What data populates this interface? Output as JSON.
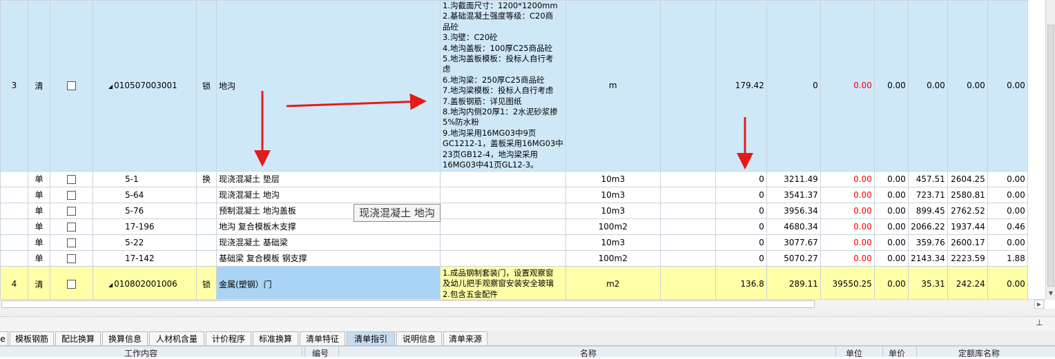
{
  "rows": [
    {
      "seq": "3",
      "type": "清",
      "code": "010507003001",
      "lock": "锁",
      "name": "地沟",
      "features": [
        "1.沟截面尺寸：1200*1200mm",
        "2.基础混凝土强度等级：C20商",
        "品砼",
        "3.沟壁：C20砼",
        "4.地沟盖板：100厚C25商品砼",
        "5.地沟盖板模板：投标人自行考",
        "虑",
        "6.地沟梁：250厚C25商品砼",
        "7.地沟梁模板：投标人自行考虑",
        "7.盖板钢筋：详见图纸",
        "8.地沟内侧20厚1：2水泥砂浆掺",
        "5%防水粉",
        "9.地沟采用16MG03中9页",
        "GC1212-1，盖板采用16MG03中",
        "23页GB12-4，地沟梁采用",
        "16MG03中41页GL12-3。"
      ],
      "unit": "m",
      "blank": "",
      "qty": "179.42",
      "price": "0",
      "total": "0.00",
      "v1": "0.00",
      "v2": "0.00",
      "v3": "0.00",
      "v4": "0.00"
    },
    {
      "seq": "",
      "type": "单",
      "code": "5-1",
      "lock": "换",
      "name": "现浇混凝土 垫层",
      "unit": "10m3",
      "blank": "",
      "qty": "0",
      "price": "3211.49",
      "total": "0.00",
      "v1": "0.00",
      "v2": "457.51",
      "v3": "2604.25",
      "v4": "0.00"
    },
    {
      "seq": "",
      "type": "单",
      "code": "5-64",
      "lock": "",
      "name": "现浇混凝土 地沟",
      "unit": "10m3",
      "blank": "",
      "qty": "0",
      "price": "3541.37",
      "total": "0.00",
      "v1": "0.00",
      "v2": "723.71",
      "v3": "2580.81",
      "v4": "0.00"
    },
    {
      "seq": "",
      "type": "单",
      "code": "5-76",
      "lock": "",
      "name": "预制混凝土 地沟盖板",
      "unit": "10m3",
      "blank": "",
      "qty": "0",
      "price": "3956.34",
      "total": "0.00",
      "v1": "0.00",
      "v2": "899.45",
      "v3": "2762.52",
      "v4": "0.00"
    },
    {
      "seq": "",
      "type": "单",
      "code": "17-196",
      "lock": "",
      "name": "地沟 复合模板木支撑",
      "unit": "100m2",
      "blank": "",
      "qty": "0",
      "price": "4680.34",
      "total": "0.00",
      "v1": "0.00",
      "v2": "2066.22",
      "v3": "1937.44",
      "v4": "0.46"
    },
    {
      "seq": "",
      "type": "单",
      "code": "5-22",
      "lock": "",
      "name": "现浇混凝土 基础梁",
      "unit": "10m3",
      "blank": "",
      "qty": "0",
      "price": "3077.67",
      "total": "0.00",
      "v1": "0.00",
      "v2": "359.76",
      "v3": "2600.17",
      "v4": "0.00"
    },
    {
      "seq": "",
      "type": "单",
      "code": "17-142",
      "lock": "",
      "name": "基础梁 复合模板 钢支撑",
      "unit": "100m2",
      "blank": "",
      "qty": "0",
      "price": "5070.27",
      "total": "0.00",
      "v1": "0.00",
      "v2": "2143.34",
      "v3": "2223.59",
      "v4": "1.88"
    },
    {
      "seq": "4",
      "type": "清",
      "code": "010802001006",
      "lock": "锁",
      "name": "金属(塑钢）门",
      "features": [
        "1.成品钢制套装门，设置观察窗",
        "及幼儿把手观察窗安装安全玻璃",
        "2.包含五金配件"
      ],
      "unit": "m2",
      "blank": "",
      "qty": "136.8",
      "price": "289.11",
      "total": "39550.25",
      "v1": "0.00",
      "v2": "35.31",
      "v3": "242.24",
      "v4": "0.00"
    }
  ],
  "tooltip": "现浇混凝土 地沟",
  "tabs": [
    {
      "label": "e"
    },
    {
      "label": "模板钢筋"
    },
    {
      "label": "配比换算"
    },
    {
      "label": "换算信息"
    },
    {
      "label": "人材机含量"
    },
    {
      "label": "计价程序"
    },
    {
      "label": "标准换算"
    },
    {
      "label": "清单特征"
    },
    {
      "label": "清单指引"
    },
    {
      "label": "说明信息"
    },
    {
      "label": "清单来源"
    }
  ],
  "active_tab": "清单指引",
  "bottom_headers": {
    "work": "工作内容",
    "code": "编号",
    "name": "名称",
    "unit1": "单位",
    "unit2": "单价",
    "quota": "定额库名称"
  },
  "colors": {
    "selected_row": "#cfe8f8",
    "highlight_row": "#ffffa8",
    "name_highlight": "#a9d4f5",
    "red_value": "#ff0000",
    "arrow": "#e31b1b"
  }
}
